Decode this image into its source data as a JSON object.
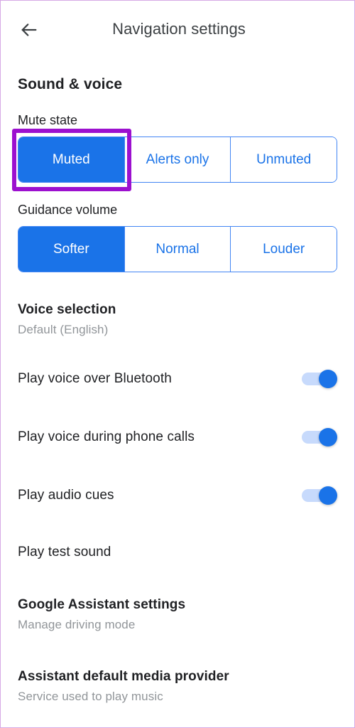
{
  "appbar": {
    "back_icon": "arrow-back-icon",
    "title": "Navigation settings"
  },
  "section": {
    "heading": "Sound & voice"
  },
  "mute_state": {
    "label": "Mute state",
    "options": [
      {
        "label": "Muted",
        "selected": true
      },
      {
        "label": "Alerts only",
        "selected": false
      },
      {
        "label": "Unmuted",
        "selected": false
      }
    ],
    "highlighted_option": "Muted"
  },
  "guidance_volume": {
    "label": "Guidance volume",
    "options": [
      {
        "label": "Softer",
        "selected": true
      },
      {
        "label": "Normal",
        "selected": false
      },
      {
        "label": "Louder",
        "selected": false
      }
    ]
  },
  "rows": {
    "voice_selection": {
      "title": "Voice selection",
      "subtitle": "Default (English)"
    },
    "play_voice_bluetooth": {
      "title": "Play voice over Bluetooth",
      "toggle_state": "on"
    },
    "play_voice_calls": {
      "title": "Play voice during phone calls",
      "toggle_state": "on"
    },
    "play_audio_cues": {
      "title": "Play audio cues",
      "toggle_state": "on"
    },
    "play_test_sound": {
      "title": "Play test sound"
    },
    "google_assistant_settings": {
      "title": "Google Assistant settings",
      "subtitle": "Manage driving mode"
    },
    "assistant_media_provider": {
      "title": "Assistant default media provider",
      "subtitle": "Service used to play music"
    }
  },
  "colors": {
    "accent_blue": "#1a73e8",
    "segment_border": "#4285f4",
    "toggle_track": "#c7dafc",
    "annotation_purple": "#9c10cf",
    "screen_border": "#d6a9e6",
    "text_primary": "#202124",
    "text_secondary": "#919599"
  }
}
